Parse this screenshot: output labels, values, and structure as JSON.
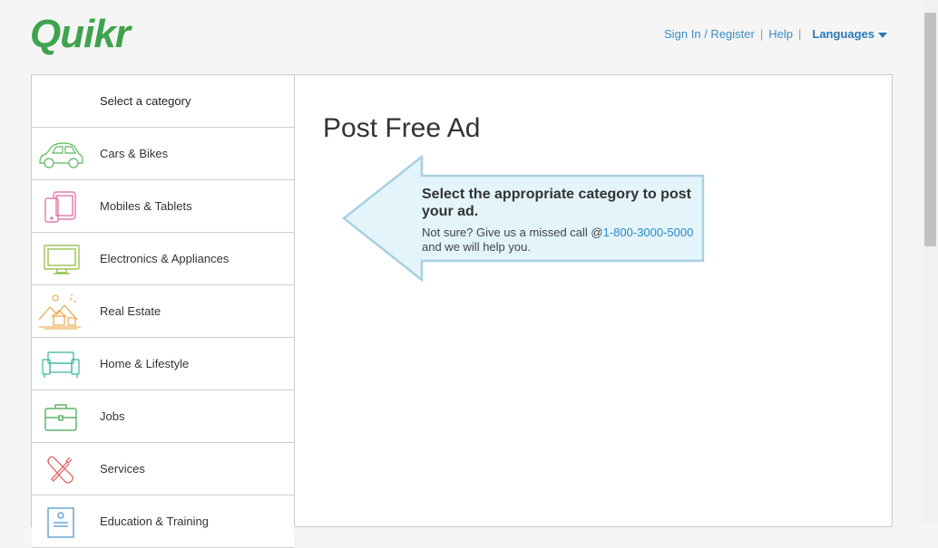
{
  "header": {
    "logo": "Quikr",
    "nav": {
      "sign_in": "Sign In / Register",
      "help": "Help",
      "languages": "Languages"
    }
  },
  "sidebar": {
    "heading": "Select a category",
    "items": [
      {
        "label": "Cars & Bikes",
        "icon": "car-icon",
        "color": "#5cb85c"
      },
      {
        "label": "Mobiles & Tablets",
        "icon": "mobile-tablet-icon",
        "color": "#d9669b"
      },
      {
        "label": "Electronics & Appliances",
        "icon": "monitor-icon",
        "color": "#8ab83a"
      },
      {
        "label": "Real Estate",
        "icon": "real-estate-icon",
        "color": "#e8a23a"
      },
      {
        "label": "Home & Lifestyle",
        "icon": "sofa-icon",
        "color": "#35b5a0"
      },
      {
        "label": "Jobs",
        "icon": "briefcase-icon",
        "color": "#3fa34d"
      },
      {
        "label": "Services",
        "icon": "tools-icon",
        "color": "#e15a5a"
      },
      {
        "label": "Education & Training",
        "icon": "education-icon",
        "color": "#4a90c8"
      }
    ]
  },
  "main": {
    "title": "Post Free Ad",
    "hint": {
      "title": "Select the appropriate category to post your ad.",
      "sub_prefix": "Not sure? Give us a missed call @",
      "phone": "1-800-3000-5000",
      "sub_suffix": "and we will help you."
    }
  },
  "colors": {
    "brand": "#3fa34d",
    "link": "#3d8cc4",
    "hint_bg": "#e3f4fb",
    "hint_border": "#a9cfe0"
  }
}
